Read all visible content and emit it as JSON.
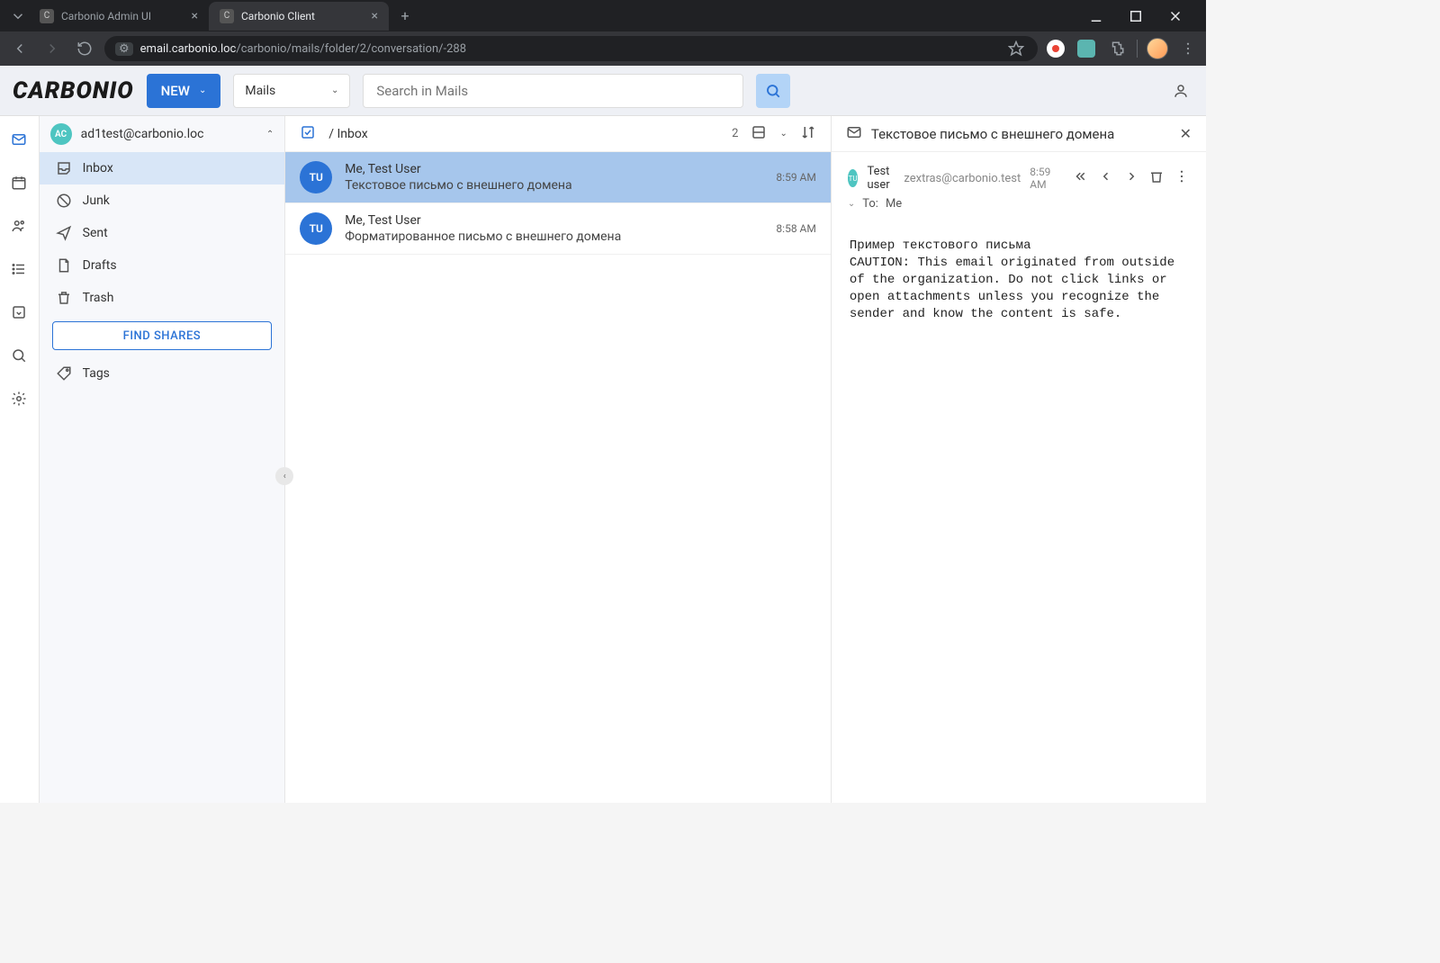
{
  "browser": {
    "tabs": [
      {
        "title": "Carbonio Admin UI",
        "active": false
      },
      {
        "title": "Carbonio Client",
        "active": true
      }
    ],
    "url_host": "email.carbonio.loc",
    "url_path": "/carbonio/mails/folder/2/conversation/-288"
  },
  "topbar": {
    "logo": "CARBONIO",
    "new_label": "NEW",
    "scope_label": "Mails",
    "search_placeholder": "Search in Mails"
  },
  "sidebar": {
    "account_initials": "AC",
    "account_email": "ad1test@carbonio.loc",
    "folders": [
      {
        "name": "Inbox",
        "active": true,
        "icon": "inbox"
      },
      {
        "name": "Junk",
        "active": false,
        "icon": "block"
      },
      {
        "name": "Sent",
        "active": false,
        "icon": "send"
      },
      {
        "name": "Drafts",
        "active": false,
        "icon": "file"
      },
      {
        "name": "Trash",
        "active": false,
        "icon": "trash"
      }
    ],
    "find_shares": "FIND SHARES",
    "tags_label": "Tags"
  },
  "list": {
    "breadcrumb": "/ Inbox",
    "count": "2",
    "messages": [
      {
        "initials": "TU",
        "from": "Me, Test User",
        "subject": "Текстовое письмо с внешнего домена",
        "time": "8:59 AM",
        "selected": true
      },
      {
        "initials": "TU",
        "from": "Me, Test User",
        "subject": "Форматированное письмо с внешнего домена",
        "time": "8:58 AM",
        "selected": false
      }
    ]
  },
  "reading": {
    "title": "Текстовое письмо с внешнего домена",
    "sender_initials": "TU",
    "sender_name": "Test user",
    "sender_email": "zextras@carbonio.test",
    "time": "8:59 AM",
    "to_label": "To:",
    "to_value": "Me",
    "body": "Пример текстового письма\nCAUTION: This email originated from outside of the organization. Do not click links or open attachments unless you recognize the sender and know the content is safe."
  }
}
